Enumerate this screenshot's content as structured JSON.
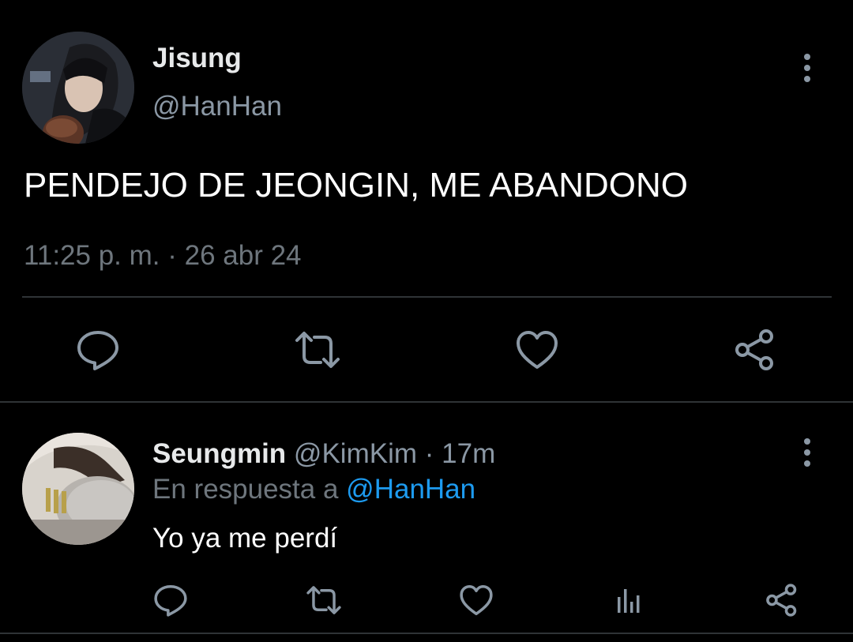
{
  "colors": {
    "background": "#000000",
    "primary_text": "#e7e9ea",
    "secondary_text": "#8b98a5",
    "muted_text": "#6e767d",
    "link": "#1d9bf0",
    "divider": "#2f3336",
    "icon": "#8b98a5"
  },
  "main_tweet": {
    "display_name": "Jisung",
    "handle": "@HanHan",
    "avatar_icon": "user-avatar-photo",
    "menu_icon": "more-vertical-icon",
    "text": "PENDEJO DE JEONGIN, ME ABANDONO",
    "meta": "11:25 p. m. · 26 abr 24",
    "actions": [
      {
        "name": "reply",
        "icon": "reply-icon"
      },
      {
        "name": "retweet",
        "icon": "retweet-icon"
      },
      {
        "name": "like",
        "icon": "heart-icon"
      },
      {
        "name": "share",
        "icon": "share-icon"
      }
    ]
  },
  "reply_tweet": {
    "display_name": "Seungmin",
    "handle": "@KimKim",
    "separator": "·",
    "time": "17m",
    "avatar_icon": "user-avatar-photo",
    "menu_icon": "more-vertical-icon",
    "reply_to_prefix": "En respuesta a",
    "reply_to_handle": "@HanHan",
    "text": "Yo ya me perdí",
    "actions": [
      {
        "name": "reply",
        "icon": "reply-icon"
      },
      {
        "name": "retweet",
        "icon": "retweet-icon"
      },
      {
        "name": "like",
        "icon": "heart-icon"
      },
      {
        "name": "views",
        "icon": "views-chart-icon"
      },
      {
        "name": "share",
        "icon": "share-icon"
      }
    ]
  }
}
